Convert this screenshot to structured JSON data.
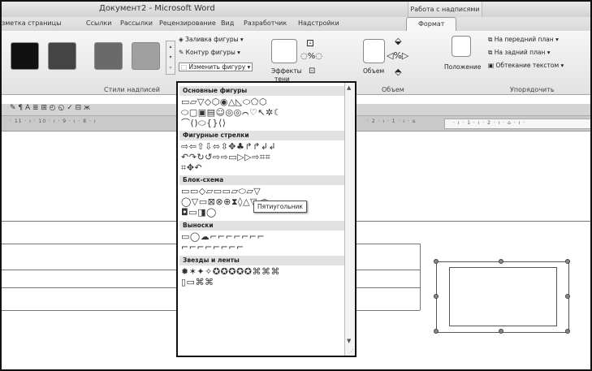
{
  "window": {
    "title": "Документ2 - Microsoft Word",
    "contextual_group": "Работа с надписями"
  },
  "tabs": [
    "зметка страницы",
    "Ссылки",
    "Рассылки",
    "Рецензирование",
    "Вид",
    "Разработчик",
    "Надстройки",
    "Формат"
  ],
  "active_tab": "Формат",
  "ribbon": {
    "swatch_colors": [
      "#111111",
      "#444444",
      "#6a6a6a",
      "#a0a0a0"
    ],
    "styles_group": "Стили надписей",
    "fill_label": "Заливка фигуры",
    "outline_label": "Контур фигуры",
    "change_shape_label": "Изменить фигуру",
    "effects_label_1": "Эффекты",
    "effects_label_2": "тени",
    "volume_button": "Объем",
    "volume_group": "Объем",
    "position_label": "Положение",
    "bring_forward": "На передний план",
    "send_backward": "На задний план",
    "text_wrap": "Обтекание текстом",
    "arrange_group": "Упорядочить"
  },
  "ruler": {
    "left_text": "· 11 · ı · 10 · ı · 9 · ı · 8 · ı",
    "mid_text": "· 2 · ı · 1 · ı · ⌂",
    "right_text": "· ı · 1 · ı · 2 · ı · ⌂ · ı ·"
  },
  "shape_gallery": {
    "categories": [
      {
        "label": "Основные фигуры",
        "rows": [
          "▭▱▽◇⬡◉△◺⬭⬠⬡",
          "⬭▢▣▤☺◎◎⌒♡↖✲☾",
          "⌒()⬭{}⟨⟩"
        ]
      },
      {
        "label": "Фигурные стрелки",
        "rows": [
          "⇨⇦⇧⇩⬄⇳✥♣↱↱↲↲",
          "↶↷↻↺⇨⇨▭▷▷⇨⌗⌗",
          "⌗✥↶"
        ]
      },
      {
        "label": "Блок-схема",
        "rows": [
          "▭▭◇▱▭▭▱⬭▱▽",
          "◯▽▭⊠⊗⊕⧗◊△▽◁▷",
          "◘▭◨◯"
        ]
      },
      {
        "label": "Выноски",
        "rows": [
          "▭◯☁⌐⌐⌐⌐⌐⌐⌐",
          "⌐⌐⌐⌐⌐⌐⌐⌐"
        ]
      },
      {
        "label": "Звезды и ленты",
        "rows": [
          "✹✶✦✧✪✪✪✪✪⌘⌘⌘",
          "▯▭⌘⌘"
        ]
      }
    ],
    "tooltip": "Пятиугольник"
  }
}
